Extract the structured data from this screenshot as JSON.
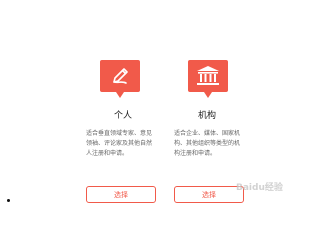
{
  "colors": {
    "accent": "#f15a4a",
    "text": "#333333",
    "muted": "#666666"
  },
  "cards": [
    {
      "icon": "pen-icon",
      "title": "个人",
      "description_lines": [
        "适合垂直领域专家、意见",
        "领袖、评论家及其他自然",
        "人注册和申请。"
      ],
      "button_label": "选择"
    },
    {
      "icon": "bank-icon",
      "title": "机构",
      "description_lines": [
        "适合企业、媒体、国家机",
        "构、其他组织等类型的机",
        "构注册和申请。"
      ],
      "button_label": "选择"
    }
  ],
  "watermark": "Baidu经验"
}
